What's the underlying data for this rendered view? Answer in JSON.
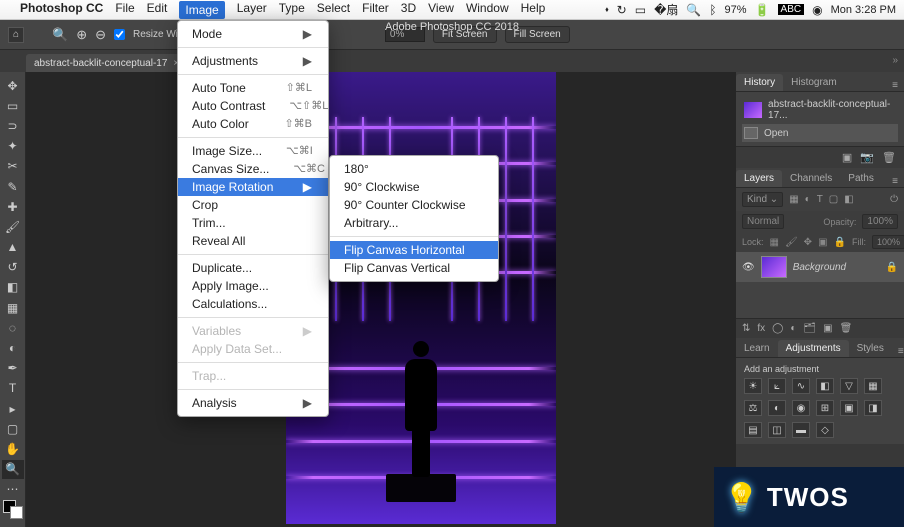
{
  "menubar": {
    "app_name": "Photoshop CC",
    "items": [
      "File",
      "Edit",
      "Image",
      "Layer",
      "Type",
      "Select",
      "Filter",
      "3D",
      "View",
      "Window",
      "Help"
    ],
    "active": "Image",
    "right": {
      "battery": "97%",
      "user": "ABC",
      "clock": "Mon 3:28 PM"
    }
  },
  "window_title": "Adobe Photoshop CC 2018",
  "options_bar": {
    "resize_checkbox_label": "Resize Windows to F",
    "zoom_value": "0%",
    "fit_screen": "Fit Screen",
    "fill_screen": "Fill Screen"
  },
  "doc_tab": {
    "label": "abstract-backlit-conceptual-17"
  },
  "image_menu": {
    "mode": "Mode",
    "adjustments": "Adjustments",
    "auto_tone": {
      "label": "Auto Tone",
      "shortcut": "⇧⌘L"
    },
    "auto_contrast": {
      "label": "Auto Contrast",
      "shortcut": "⌥⇧⌘L"
    },
    "auto_color": {
      "label": "Auto Color",
      "shortcut": "⇧⌘B"
    },
    "image_size": {
      "label": "Image Size...",
      "shortcut": "⌥⌘I"
    },
    "canvas_size": {
      "label": "Canvas Size...",
      "shortcut": "⌥⌘C"
    },
    "image_rotation": "Image Rotation",
    "crop": "Crop",
    "trim": "Trim...",
    "reveal_all": "Reveal All",
    "duplicate": "Duplicate...",
    "apply_image": "Apply Image...",
    "calculations": "Calculations...",
    "variables": "Variables",
    "apply_data_set": "Apply Data Set...",
    "trap": "Trap...",
    "analysis": "Analysis"
  },
  "rotation_submenu": {
    "r180": "180°",
    "cw": "90° Clockwise",
    "ccw": "90° Counter Clockwise",
    "arbitrary": "Arbitrary...",
    "flip_h": "Flip Canvas Horizontal",
    "flip_v": "Flip Canvas Vertical"
  },
  "history_panel": {
    "tab1": "History",
    "tab2": "Histogram",
    "entry": "abstract-backlit-conceptual-17...",
    "open": "Open"
  },
  "layers_panel": {
    "tab_layers": "Layers",
    "tab_channels": "Channels",
    "tab_paths": "Paths",
    "kind_label": "Kind",
    "blend_mode": "Normal",
    "opacity_label": "Opacity:",
    "opacity_value": "100%",
    "lock_label": "Lock:",
    "fill_label": "Fill:",
    "fill_value": "100%",
    "layer_name": "Background"
  },
  "adjust_panel": {
    "tab_learn": "Learn",
    "tab_adjust": "Adjustments",
    "tab_styles": "Styles",
    "title": "Add an adjustment"
  },
  "watermark": "TWOS"
}
